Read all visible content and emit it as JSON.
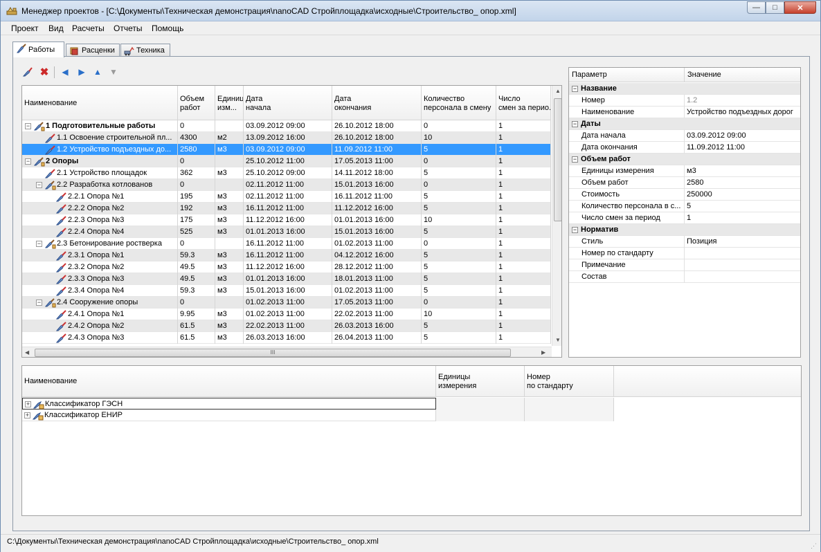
{
  "window": {
    "title": "Менеджер проектов - [C:\\Документы\\Техническая демонстрация\\nanoCAD Стройплощадка\\исходные\\Строительство_ опор.xml]",
    "minimize": "—",
    "maximize": "□",
    "close": "✕"
  },
  "menu": [
    "Проект",
    "Вид",
    "Расчеты",
    "Отчеты",
    "Помощь"
  ],
  "tabs": [
    "Работы",
    "Расценки",
    "Техника"
  ],
  "toolbar": {
    "icons": [
      "edit-icon",
      "delete-icon",
      "arrow-left-icon",
      "arrow-right-icon",
      "arrow-up-icon",
      "arrow-down-icon"
    ],
    "delete_glyph": "✖",
    "left_glyph": "◀",
    "right_glyph": "▶",
    "up_glyph": "▲",
    "down_glyph": "▼"
  },
  "works_grid": {
    "headers": [
      {
        "l1": "Наименование",
        "l2": ""
      },
      {
        "l1": "Объем",
        "l2": "работ"
      },
      {
        "l1": "Единиц",
        "l2": "изм..."
      },
      {
        "l1": "Дата",
        "l2": "начала"
      },
      {
        "l1": "Дата",
        "l2": "окончания"
      },
      {
        "l1": "Количество",
        "l2": "персонала в смену"
      },
      {
        "l1": "Число",
        "l2": "смен за перио..."
      }
    ],
    "rows": [
      {
        "name": "1 Подготовительные работы",
        "level": 0,
        "expander": "−",
        "bold": true,
        "volume": "0",
        "unit": "",
        "start": "03.09.2012 09:00",
        "end": "26.10.2012 18:00",
        "staff": "0",
        "shifts": "1"
      },
      {
        "name": "1.1 Освоение строительной пл...",
        "level": 1,
        "expander": "",
        "bold": false,
        "volume": "4300",
        "unit": "м2",
        "start": "13.09.2012 16:00",
        "end": "26.10.2012 18:00",
        "staff": "10",
        "shifts": "1"
      },
      {
        "name": "1.2 Устройство подъездных до...",
        "level": 1,
        "expander": "",
        "bold": false,
        "selected": true,
        "volume": "2580",
        "unit": "м3",
        "start": "03.09.2012 09:00",
        "end": "11.09.2012 11:00",
        "staff": "5",
        "shifts": "1"
      },
      {
        "name": "2 Опоры",
        "level": 0,
        "expander": "−",
        "bold": true,
        "volume": "0",
        "unit": "",
        "start": "25.10.2012 11:00",
        "end": "17.05.2013 11:00",
        "staff": "0",
        "shifts": "1"
      },
      {
        "name": "2.1 Устройство площадок",
        "level": 1,
        "expander": "",
        "bold": false,
        "volume": "362",
        "unit": "м3",
        "start": "25.10.2012 09:00",
        "end": "14.11.2012 18:00",
        "staff": "5",
        "shifts": "1"
      },
      {
        "name": "2.2 Разработка котлованов",
        "level": 1,
        "expander": "−",
        "bold": false,
        "volume": "0",
        "unit": "",
        "start": "02.11.2012 11:00",
        "end": "15.01.2013 16:00",
        "staff": "0",
        "shifts": "1"
      },
      {
        "name": "2.2.1 Опора №1",
        "level": 2,
        "expander": "",
        "bold": false,
        "volume": "195",
        "unit": "м3",
        "start": "02.11.2012 11:00",
        "end": "16.11.2012 11:00",
        "staff": "5",
        "shifts": "1"
      },
      {
        "name": "2.2.2 Опора №2",
        "level": 2,
        "expander": "",
        "bold": false,
        "volume": "192",
        "unit": "м3",
        "start": "16.11.2012 11:00",
        "end": "11.12.2012 16:00",
        "staff": "5",
        "shifts": "1"
      },
      {
        "name": "2.2.3 Опора №3",
        "level": 2,
        "expander": "",
        "bold": false,
        "volume": "175",
        "unit": "м3",
        "start": "11.12.2012 16:00",
        "end": "01.01.2013 16:00",
        "staff": "10",
        "shifts": "1"
      },
      {
        "name": "2.2.4 Опора №4",
        "level": 2,
        "expander": "",
        "bold": false,
        "volume": "525",
        "unit": "м3",
        "start": "01.01.2013 16:00",
        "end": "15.01.2013 16:00",
        "staff": "5",
        "shifts": "1"
      },
      {
        "name": "2.3 Бетонирование ростверка",
        "level": 1,
        "expander": "−",
        "bold": false,
        "volume": "0",
        "unit": "",
        "start": "16.11.2012 11:00",
        "end": "01.02.2013 11:00",
        "staff": "0",
        "shifts": "1"
      },
      {
        "name": "2.3.1 Опора №1",
        "level": 2,
        "expander": "",
        "bold": false,
        "volume": "59.3",
        "unit": "м3",
        "start": "16.11.2012 11:00",
        "end": "04.12.2012 16:00",
        "staff": "5",
        "shifts": "1"
      },
      {
        "name": "2.3.2 Опора №2",
        "level": 2,
        "expander": "",
        "bold": false,
        "volume": "49.5",
        "unit": "м3",
        "start": "11.12.2012 16:00",
        "end": "28.12.2012 11:00",
        "staff": "5",
        "shifts": "1"
      },
      {
        "name": "2.3.3 Опора №3",
        "level": 2,
        "expander": "",
        "bold": false,
        "volume": "49.5",
        "unit": "м3",
        "start": "01.01.2013 16:00",
        "end": "18.01.2013 11:00",
        "staff": "5",
        "shifts": "1"
      },
      {
        "name": "2.3.4 Опора №4",
        "level": 2,
        "expander": "",
        "bold": false,
        "volume": "59.3",
        "unit": "м3",
        "start": "15.01.2013 16:00",
        "end": "01.02.2013 11:00",
        "staff": "5",
        "shifts": "1"
      },
      {
        "name": "2.4 Сооружение опоры",
        "level": 1,
        "expander": "−",
        "bold": false,
        "volume": "0",
        "unit": "",
        "start": "01.02.2013 11:00",
        "end": "17.05.2013 11:00",
        "staff": "0",
        "shifts": "1"
      },
      {
        "name": "2.4.1 Опора №1",
        "level": 2,
        "expander": "",
        "bold": false,
        "volume": "9.95",
        "unit": "м3",
        "start": "01.02.2013 11:00",
        "end": "22.02.2013 11:00",
        "staff": "10",
        "shifts": "1"
      },
      {
        "name": "2.4.2 Опора №2",
        "level": 2,
        "expander": "",
        "bold": false,
        "volume": "61.5",
        "unit": "м3",
        "start": "22.02.2013 11:00",
        "end": "26.03.2013 16:00",
        "staff": "5",
        "shifts": "1"
      },
      {
        "name": "2.4.3 Опора №3",
        "level": 2,
        "expander": "",
        "bold": false,
        "volume": "61.5",
        "unit": "м3",
        "start": "26.03.2013 16:00",
        "end": "26.04.2013 11:00",
        "staff": "5",
        "shifts": "1"
      }
    ],
    "hscroll_grip": "III",
    "scroll_up": "▲",
    "scroll_down": "▼",
    "scroll_left": "◀",
    "scroll_right": "▶"
  },
  "properties": {
    "headers": [
      "Параметр",
      "Значение"
    ],
    "rows": [
      {
        "type": "cat",
        "label": "Название",
        "expander": "−"
      },
      {
        "type": "prop",
        "label": "Номер",
        "value": "1.2",
        "disabled": true
      },
      {
        "type": "prop",
        "label": "Наименование",
        "value": "Устройство подъездных дорог"
      },
      {
        "type": "cat",
        "label": "Даты",
        "expander": "−"
      },
      {
        "type": "prop",
        "label": "Дата начала",
        "value": "03.09.2012 09:00"
      },
      {
        "type": "prop",
        "label": "Дата окончания",
        "value": "11.09.2012 11:00"
      },
      {
        "type": "cat",
        "label": "Объем работ",
        "expander": "−"
      },
      {
        "type": "prop",
        "label": "Единицы измерения",
        "value": "м3"
      },
      {
        "type": "prop",
        "label": "Объем работ",
        "value": "2580"
      },
      {
        "type": "prop",
        "label": "Стоимость",
        "value": "250000"
      },
      {
        "type": "prop",
        "label": "Количество персонала в с...",
        "value": "5"
      },
      {
        "type": "prop",
        "label": "Число смен за период",
        "value": "1"
      },
      {
        "type": "cat",
        "label": "Норматив",
        "expander": "−"
      },
      {
        "type": "prop",
        "label": "Стиль",
        "value": "Позиция"
      },
      {
        "type": "prop",
        "label": "Номер по стандарту",
        "value": ""
      },
      {
        "type": "prop",
        "label": "Примечание",
        "value": ""
      },
      {
        "type": "prop",
        "label": "Состав",
        "value": ""
      }
    ]
  },
  "classifier": {
    "headers": [
      {
        "l1": "Наименование",
        "l2": ""
      },
      {
        "l1": "Единицы",
        "l2": "измерения"
      },
      {
        "l1": "Номер",
        "l2": "по стандарту"
      }
    ],
    "rows": [
      {
        "name": "Классификатор ГЭСН",
        "expander": "+",
        "unit": "",
        "std": ""
      },
      {
        "name": "Классификатор ЕНИР",
        "expander": "+",
        "unit": "",
        "std": ""
      }
    ]
  },
  "status": {
    "path": "C:\\Документы\\Техническая демонстрация\\nanoCAD Стройплощадка\\исходные\\Строительство_ опор.xml"
  },
  "colors": {
    "selection": "#3399ff",
    "alt_row": "#e8e8e8",
    "delete_red": "#cc2a2a",
    "arrow_blue": "#2a6fc9"
  }
}
